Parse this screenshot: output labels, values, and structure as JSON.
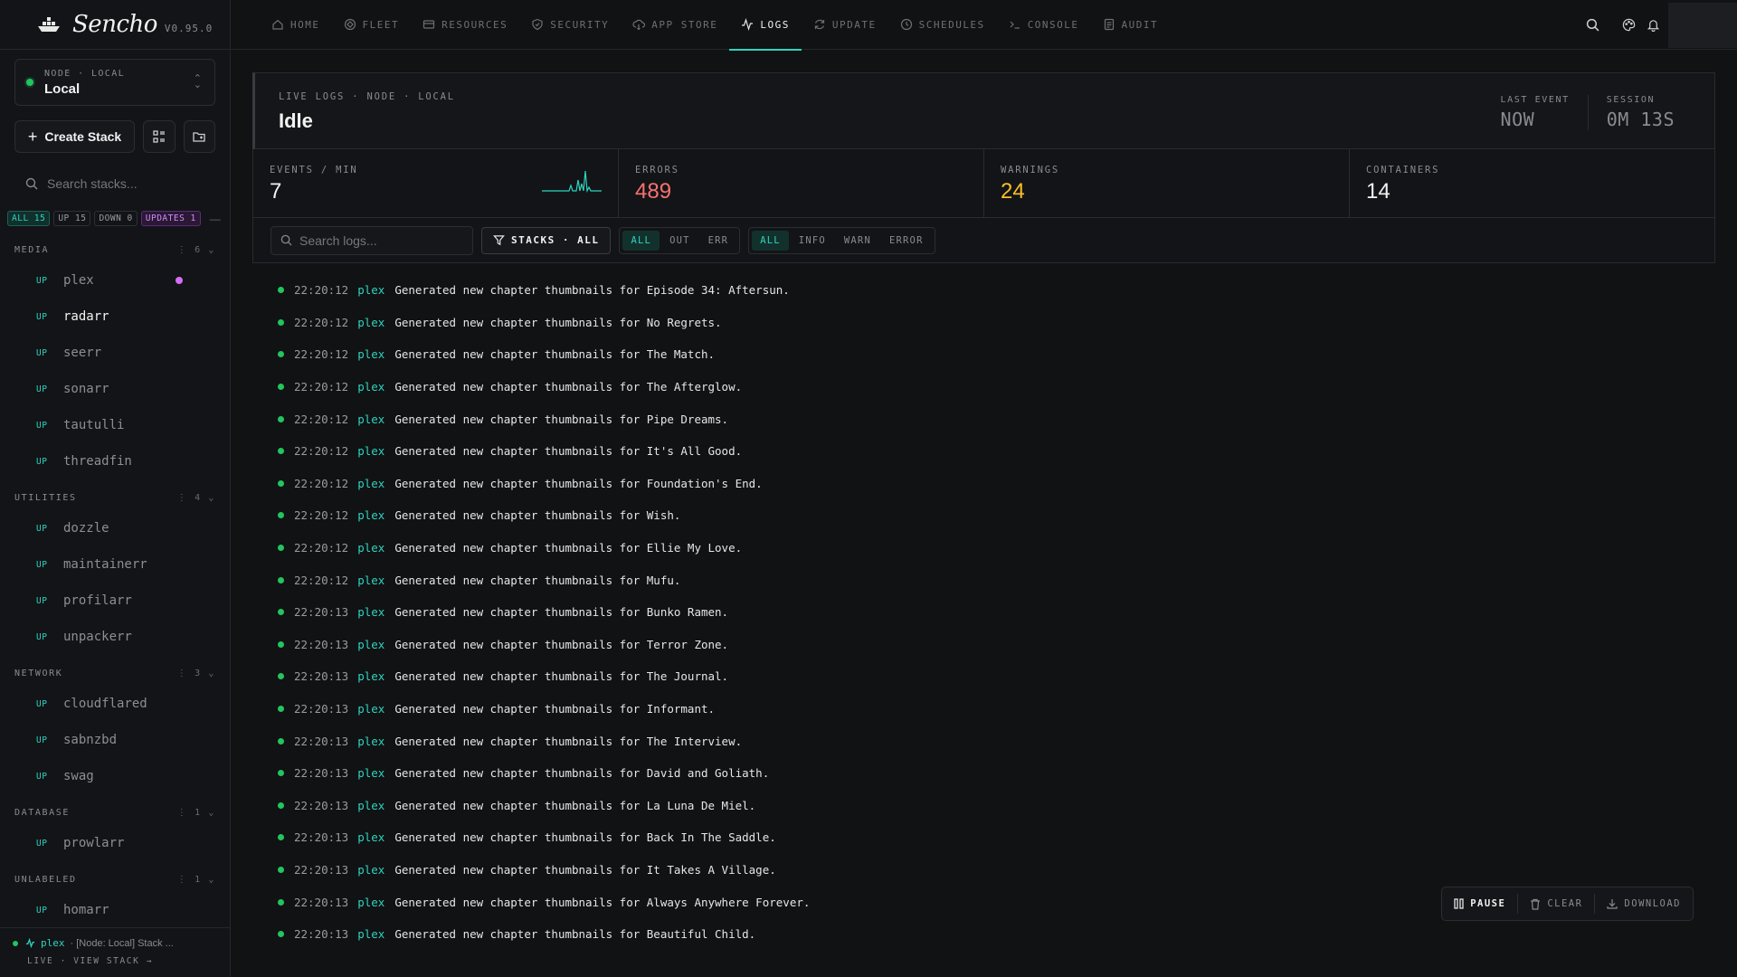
{
  "brand": {
    "name": "Sencho",
    "version": "V0.95.0"
  },
  "node": {
    "label": "NODE · LOCAL",
    "name": "Local"
  },
  "actions": {
    "create_stack": "Create Stack"
  },
  "sidebar_search": {
    "placeholder": "Search stacks..."
  },
  "filters": [
    {
      "label": "ALL 15",
      "kind": "active"
    },
    {
      "label": "UP 15",
      "kind": ""
    },
    {
      "label": "DOWN 0",
      "kind": ""
    },
    {
      "label": "UPDATES 1",
      "kind": "upd"
    }
  ],
  "groups": [
    {
      "name": "MEDIA",
      "count": "6",
      "stacks": [
        {
          "status": "UP",
          "name": "plex",
          "indicator": true
        },
        {
          "status": "UP",
          "name": "radarr",
          "active": true
        },
        {
          "status": "UP",
          "name": "seerr"
        },
        {
          "status": "UP",
          "name": "sonarr"
        },
        {
          "status": "UP",
          "name": "tautulli"
        },
        {
          "status": "UP",
          "name": "threadfin"
        }
      ]
    },
    {
      "name": "UTILITIES",
      "count": "4",
      "stacks": [
        {
          "status": "UP",
          "name": "dozzle"
        },
        {
          "status": "UP",
          "name": "maintainerr"
        },
        {
          "status": "UP",
          "name": "profilarr"
        },
        {
          "status": "UP",
          "name": "unpackerr"
        }
      ]
    },
    {
      "name": "NETWORK",
      "count": "3",
      "stacks": [
        {
          "status": "UP",
          "name": "cloudflared"
        },
        {
          "status": "UP",
          "name": "sabnzbd"
        },
        {
          "status": "UP",
          "name": "swag"
        }
      ]
    },
    {
      "name": "DATABASE",
      "count": "1",
      "stacks": [
        {
          "status": "UP",
          "name": "prowlarr"
        }
      ]
    },
    {
      "name": "UNLABELED",
      "count": "1",
      "stacks": [
        {
          "status": "UP",
          "name": "homarr"
        }
      ]
    }
  ],
  "footer": {
    "service": "plex",
    "text": "· [Node: Local] Stack ...",
    "line2": "LIVE · VIEW STACK →"
  },
  "nav": [
    {
      "label": "HOME",
      "icon": "home-icon"
    },
    {
      "label": "FLEET",
      "icon": "fleet-icon"
    },
    {
      "label": "RESOURCES",
      "icon": "resources-icon"
    },
    {
      "label": "SECURITY",
      "icon": "shield-icon"
    },
    {
      "label": "APP STORE",
      "icon": "cloud-download-icon"
    },
    {
      "label": "LOGS",
      "icon": "activity-icon",
      "active": true
    },
    {
      "label": "UPDATE",
      "icon": "refresh-icon"
    },
    {
      "label": "SCHEDULES",
      "icon": "clock-icon"
    },
    {
      "label": "CONSOLE",
      "icon": "terminal-icon"
    },
    {
      "label": "AUDIT",
      "icon": "audit-icon"
    }
  ],
  "header": {
    "crumb": "LIVE LOGS · NODE · LOCAL",
    "status": "Idle",
    "last_event_label": "LAST EVENT",
    "last_event_value": "NOW",
    "session_label": "SESSION",
    "session_value": "0M 13S"
  },
  "metrics": {
    "events_label": "EVENTS / MIN",
    "events_value": "7",
    "errors_label": "ERRORS",
    "errors_value": "489",
    "warnings_label": "WARNINGS",
    "warnings_value": "24",
    "containers_label": "CONTAINERS",
    "containers_value": "14"
  },
  "toolbar": {
    "search_placeholder": "Search logs...",
    "stacks_label": "STACKS · ALL",
    "streams": [
      "ALL",
      "OUT",
      "ERR"
    ],
    "levels": [
      "ALL",
      "INFO",
      "WARN",
      "ERROR"
    ]
  },
  "logs": [
    {
      "time": "22:20:12",
      "service": "plex",
      "message": "Generated new chapter thumbnails for Episode 34: Aftersun."
    },
    {
      "time": "22:20:12",
      "service": "plex",
      "message": "Generated new chapter thumbnails for No Regrets."
    },
    {
      "time": "22:20:12",
      "service": "plex",
      "message": "Generated new chapter thumbnails for The Match."
    },
    {
      "time": "22:20:12",
      "service": "plex",
      "message": "Generated new chapter thumbnails for The Afterglow."
    },
    {
      "time": "22:20:12",
      "service": "plex",
      "message": "Generated new chapter thumbnails for Pipe Dreams."
    },
    {
      "time": "22:20:12",
      "service": "plex",
      "message": "Generated new chapter thumbnails for It's All Good."
    },
    {
      "time": "22:20:12",
      "service": "plex",
      "message": "Generated new chapter thumbnails for Foundation's End."
    },
    {
      "time": "22:20:12",
      "service": "plex",
      "message": "Generated new chapter thumbnails for Wish."
    },
    {
      "time": "22:20:12",
      "service": "plex",
      "message": "Generated new chapter thumbnails for Ellie My Love."
    },
    {
      "time": "22:20:12",
      "service": "plex",
      "message": "Generated new chapter thumbnails for Mufu."
    },
    {
      "time": "22:20:13",
      "service": "plex",
      "message": "Generated new chapter thumbnails for Bunko Ramen."
    },
    {
      "time": "22:20:13",
      "service": "plex",
      "message": "Generated new chapter thumbnails for Terror Zone."
    },
    {
      "time": "22:20:13",
      "service": "plex",
      "message": "Generated new chapter thumbnails for The Journal."
    },
    {
      "time": "22:20:13",
      "service": "plex",
      "message": "Generated new chapter thumbnails for Informant."
    },
    {
      "time": "22:20:13",
      "service": "plex",
      "message": "Generated new chapter thumbnails for The Interview."
    },
    {
      "time": "22:20:13",
      "service": "plex",
      "message": "Generated new chapter thumbnails for David and Goliath."
    },
    {
      "time": "22:20:13",
      "service": "plex",
      "message": "Generated new chapter thumbnails for La Luna De Miel."
    },
    {
      "time": "22:20:13",
      "service": "plex",
      "message": "Generated new chapter thumbnails for Back In The Saddle."
    },
    {
      "time": "22:20:13",
      "service": "plex",
      "message": "Generated new chapter thumbnails for It Takes A Village."
    },
    {
      "time": "22:20:13",
      "service": "plex",
      "message": "Generated new chapter thumbnails for Always Anywhere Forever."
    },
    {
      "time": "22:20:13",
      "service": "plex",
      "message": "Generated new chapter thumbnails for Beautiful Child."
    }
  ],
  "controls": {
    "pause": "PAUSE",
    "clear": "CLEAR",
    "download": "DOWNLOAD"
  },
  "colors": {
    "accent": "#2dd4bf",
    "ok": "#22c55e",
    "error": "#f87171",
    "warning": "#fbbf24",
    "update": "#d46ef5"
  }
}
